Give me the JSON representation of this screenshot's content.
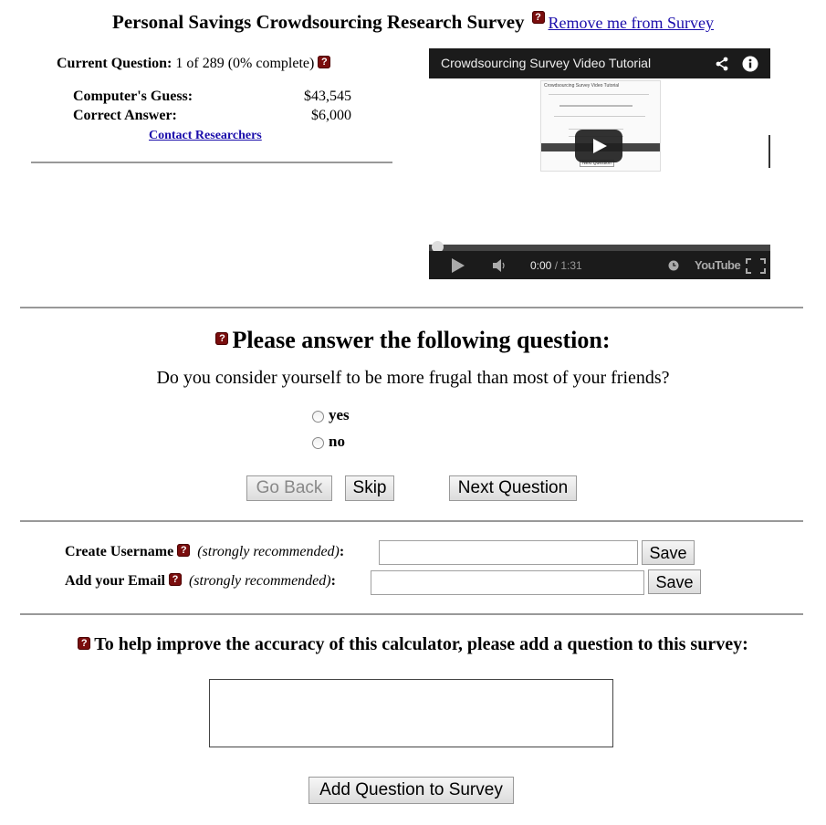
{
  "header": {
    "title": "Personal Savings Crowdsourcing Research Survey",
    "help_glyph": "?",
    "remove_link": "Remove me from Survey"
  },
  "status": {
    "current_label": "Current Question:",
    "current_value": "1 of 289 (0% complete)",
    "guess_label": "Computer's Guess:",
    "guess_value": "$43,545",
    "answer_label": "Correct Answer:",
    "answer_value": "$6,000",
    "contact_link": "Contact Researchers"
  },
  "video": {
    "title": "Crowdsourcing Survey Video Tutorial",
    "time_current": "0:00",
    "time_total": "/ 1:31",
    "youtube_label": "YouTube",
    "inner_title": "Crowdsourcing Survey Video Tutorial",
    "inner_caption": "Next Question",
    "progress": 0
  },
  "question": {
    "heading": "Please answer the following question:",
    "text": "Do you consider yourself to be more frugal than most of your friends?",
    "options": [
      "yes",
      "no"
    ]
  },
  "buttons": {
    "back": "Go Back",
    "skip": "Skip",
    "next": "Next Question"
  },
  "account": {
    "username_label": "Create Username",
    "email_label": "Add your Email",
    "recommended": "(strongly recommended)",
    "colon": ":",
    "save": "Save",
    "username_value": "",
    "email_value": ""
  },
  "improve": {
    "heading": "To help improve the accuracy of this calculator, please add a question to this survey:",
    "textarea_value": "",
    "add_button": "Add Question to Survey"
  },
  "colors": {
    "help_icon": "#7a0d0d",
    "link": "#1a0dab",
    "video_bg": "#1b1b1b"
  }
}
